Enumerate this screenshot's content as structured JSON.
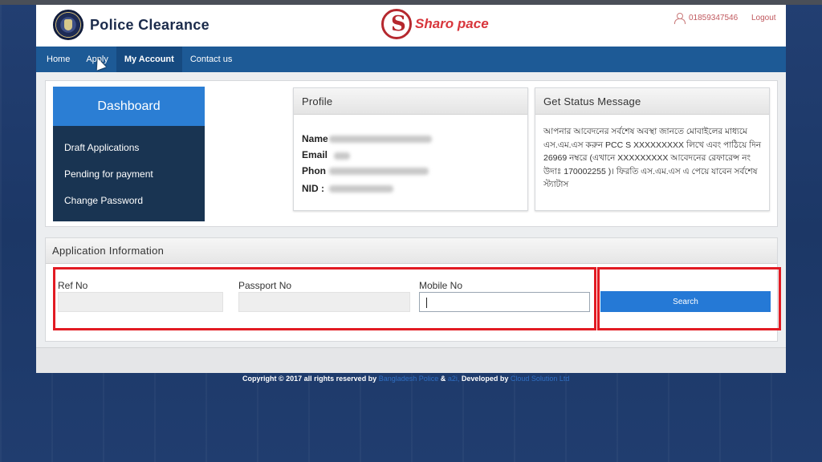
{
  "header": {
    "app_title": "Police Clearance",
    "brand_text": "Sharo pace",
    "phone": "01859347546",
    "logout_label": "Logout"
  },
  "nav": {
    "items": [
      {
        "label": "Home"
      },
      {
        "label": "Apply"
      },
      {
        "label": "My Account"
      },
      {
        "label": "Contact us"
      }
    ]
  },
  "dashboard": {
    "title": "Dashboard",
    "items": [
      {
        "label": "Draft Applications"
      },
      {
        "label": "Pending for payment"
      },
      {
        "label": "Change Password"
      }
    ]
  },
  "profile": {
    "title": "Profile",
    "rows": [
      {
        "label": "Name"
      },
      {
        "label": "Email"
      },
      {
        "label": "Phon"
      },
      {
        "label": "NID :"
      }
    ]
  },
  "status": {
    "title": "Get Status Message",
    "message": "আপনার আবেদনের সর্বশেষ অবস্থা জানতে মোবাইলের মাধ্যমে এস.এম.এস করুন PCC S XXXXXXXXX লিখে এবং পাঠিয়ে দিন 26969 নম্বরে (এখানে XXXXXXXXX আবেদনের রেফারেন্স নং উদাঃ 170002255 )। ফিরতি এস.এম.এস এ পেয়ে যাবেন সর্বশেষ স্ট্যাটাস"
  },
  "application": {
    "title": "Application Information",
    "ref_label": "Ref No",
    "ref_value": "",
    "passport_label": "Passport No",
    "passport_value": "",
    "mobile_label": "Mobile No",
    "mobile_value": "",
    "search_label": "Search"
  },
  "footer": {
    "copyright": "Copyright © 2017 all rights reserved by",
    "org": "Bangladesh Police",
    "amp": "&",
    "partner": "a2i,",
    "developed": "Developed by",
    "dev_org": "Cloud Solution Ltd"
  },
  "colors": {
    "nav_bg": "#1d5a96",
    "accent": "#2b7ed4",
    "highlight": "#e21b23",
    "dashboard_bg": "#193452"
  }
}
